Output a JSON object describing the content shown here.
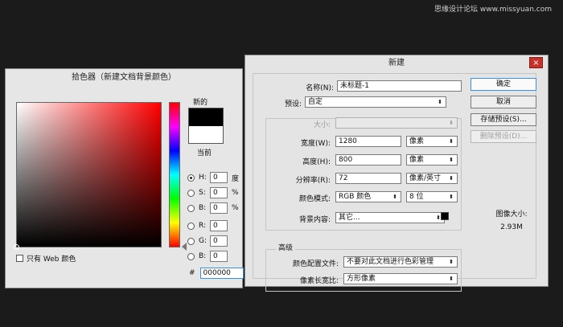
{
  "watermark": "思缘设计论坛 www.missyuan.com",
  "picker": {
    "title": "拾色器（新建文档背景颜色）",
    "new_label": "新的",
    "current_label": "当前",
    "web_only_label": "只有 Web 颜色",
    "new_color": "#000000",
    "current_color": "#ffffff",
    "fields": [
      {
        "label": "H:",
        "value": "0",
        "unit": "度",
        "selected": true
      },
      {
        "label": "S:",
        "value": "0",
        "unit": "%",
        "selected": false
      },
      {
        "label": "B:",
        "value": "0",
        "unit": "%",
        "selected": false
      },
      {
        "label": "R:",
        "value": "0",
        "unit": "",
        "selected": false
      },
      {
        "label": "G:",
        "value": "0",
        "unit": "",
        "selected": false
      },
      {
        "label": "B:",
        "value": "0",
        "unit": "",
        "selected": false
      }
    ],
    "hex_label": "#",
    "hex_value": "000000"
  },
  "newdoc": {
    "title": "新建",
    "close_icon": "×",
    "name_label": "名称(N):",
    "name_value": "未标题-1",
    "preset_label": "预设:",
    "preset_value": "自定",
    "size_label": "大小:",
    "size_value": "",
    "width_label": "宽度(W):",
    "width_value": "1280",
    "width_unit": "像素",
    "height_label": "高度(H):",
    "height_value": "800",
    "height_unit": "像素",
    "resolution_label": "分辨率(R):",
    "resolution_value": "72",
    "resolution_unit": "像素/英寸",
    "color_mode_label": "颜色模式:",
    "color_mode_value": "RGB 颜色",
    "bit_depth_value": "8 位",
    "background_label": "背景内容:",
    "background_value": "其它...",
    "background_color": "#000000",
    "advanced_label": "高级",
    "color_profile_label": "颜色配置文件:",
    "color_profile_value": "不要对此文档进行色彩管理",
    "pixel_aspect_label": "像素长宽比:",
    "pixel_aspect_value": "方形像素",
    "buttons": {
      "ok": "确定",
      "cancel": "取消",
      "save_preset": "存储预设(S)...",
      "delete_preset": "删除预设(D)..."
    },
    "image_size_label": "图像大小:",
    "image_size_value": "2.93M"
  }
}
